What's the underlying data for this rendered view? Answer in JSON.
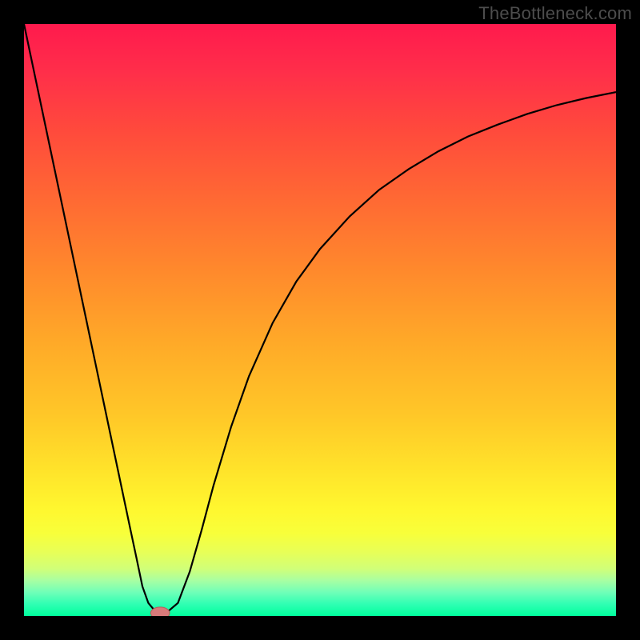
{
  "watermark": "TheBottleneck.com",
  "colors": {
    "frame": "#000000",
    "curve_stroke": "#000000",
    "marker_fill": "#d87a7a",
    "marker_stroke": "#b95a5a",
    "gradient_top": "#ff1a4d",
    "gradient_bottom": "#00ff9c"
  },
  "chart_data": {
    "type": "line",
    "title": "",
    "xlabel": "",
    "ylabel": "",
    "xlim": [
      0,
      100
    ],
    "ylim": [
      0,
      100
    ],
    "grid": false,
    "legend": null,
    "annotations": [],
    "series": [
      {
        "name": "bottleneck-curve",
        "x": [
          0,
          2,
          4,
          6,
          8,
          10,
          12,
          14,
          16,
          18,
          19,
          20,
          21,
          22,
          23,
          24,
          26,
          28,
          30,
          32,
          35,
          38,
          42,
          46,
          50,
          55,
          60,
          65,
          70,
          75,
          80,
          85,
          90,
          95,
          100
        ],
        "y": [
          100,
          90.5,
          81,
          71.5,
          62,
          52.5,
          43,
          33.5,
          24,
          14.5,
          9.8,
          5,
          2.2,
          1.0,
          0.5,
          0.5,
          2.2,
          7.5,
          14.5,
          22,
          32,
          40.5,
          49.5,
          56.5,
          62,
          67.5,
          72,
          75.5,
          78.5,
          81,
          83,
          84.8,
          86.3,
          87.5,
          88.5
        ]
      }
    ],
    "marker": {
      "name": "optimal-point",
      "x": 23,
      "y": 0.5,
      "rx_pct": 1.6,
      "ry_pct": 1.0
    }
  }
}
